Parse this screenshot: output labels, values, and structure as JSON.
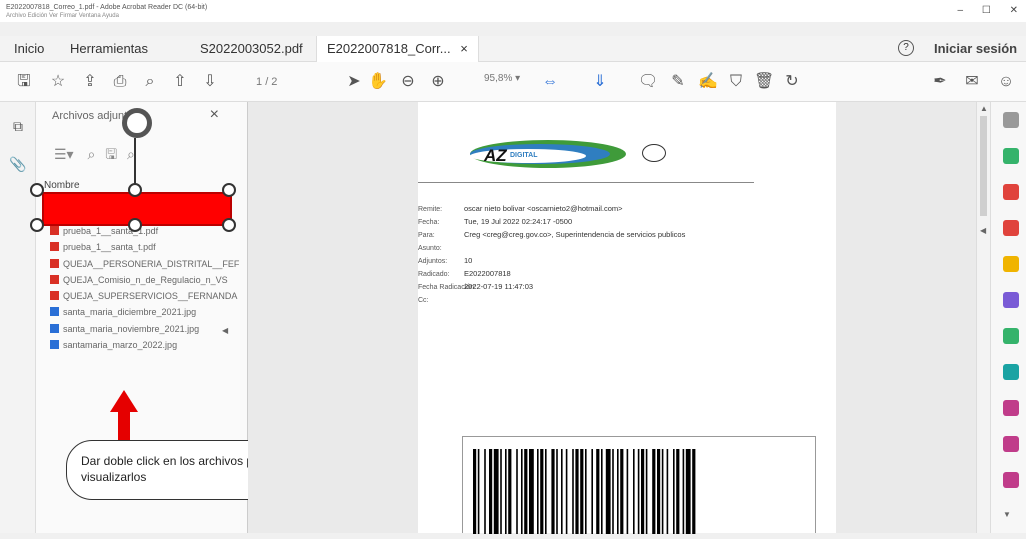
{
  "window": {
    "title": "E2022007818_Correo_1.pdf - Adobe Acrobat Reader DC (64-bit)",
    "menu": "Archivo  Edición  Ver  Firmar  Ventana  Ayuda",
    "controls": [
      "–",
      "☐",
      "✕"
    ]
  },
  "tabs": {
    "inicio": "Inicio",
    "herramientas": "Herramientas",
    "doc1": "S2022003052.pdf",
    "doc2": "E2022007818_Corr...",
    "doc2_close": "×",
    "help": "?",
    "signin": "Iniciar sesión"
  },
  "toolbar": {
    "page": "1",
    "page_total": "/ 2",
    "zoom": "95,8%",
    "zoom_arrow": "▾"
  },
  "panel": {
    "title": "Archivos adjuntos",
    "close": "×",
    "header": "Nombre",
    "files": [
      {
        "type": "pdf",
        "name": "prueba_1__santa_1.pdf"
      },
      {
        "type": "pdf",
        "name": "prueba_1__santa_t.pdf"
      },
      {
        "type": "pdf",
        "name": "QUEJA__PERSONERIA_DISTRITAL__FEF"
      },
      {
        "type": "pdf",
        "name": "QUEJA_Comisio_n_de_Regulacio_n_VS"
      },
      {
        "type": "pdf",
        "name": "QUEJA_SUPERSERVICIOS__FERNANDA"
      },
      {
        "type": "img",
        "name": "santa_maria_diciembre_2021.jpg"
      },
      {
        "type": "img",
        "name": "santa_maria_noviembre_2021.jpg"
      },
      {
        "type": "img",
        "name": "santamaria_marzo_2022.jpg"
      }
    ]
  },
  "callout": {
    "text": "Dar doble click en los archivos para poder visualizarlos"
  },
  "document": {
    "logo_az": "AZ",
    "logo_digital": "DIGITAL",
    "fields": [
      {
        "label": "Remite:",
        "value": "oscar nieto bolivar <oscarnieto2@hotmail.com>"
      },
      {
        "label": "Fecha:",
        "value": "Tue, 19 Jul 2022 02:24:17 -0500"
      },
      {
        "label": "Para:",
        "value": "Creg <creg@creg.gov.co>, Superintendencia de servicios publicos"
      },
      {
        "label": "Asunto:",
        "value": ""
      },
      {
        "label": "Adjuntos:",
        "value": "10"
      },
      {
        "label": "Radicado:",
        "value": "E2022007818"
      },
      {
        "label": "Fecha Radicación:",
        "value": "2022-07-19 11:47:03"
      },
      {
        "label": "Cc:",
        "value": ""
      }
    ]
  },
  "colors": {
    "accent_red": "#ff0000",
    "arrow_red": "#e50000",
    "link_blue": "#1a5fd0"
  }
}
